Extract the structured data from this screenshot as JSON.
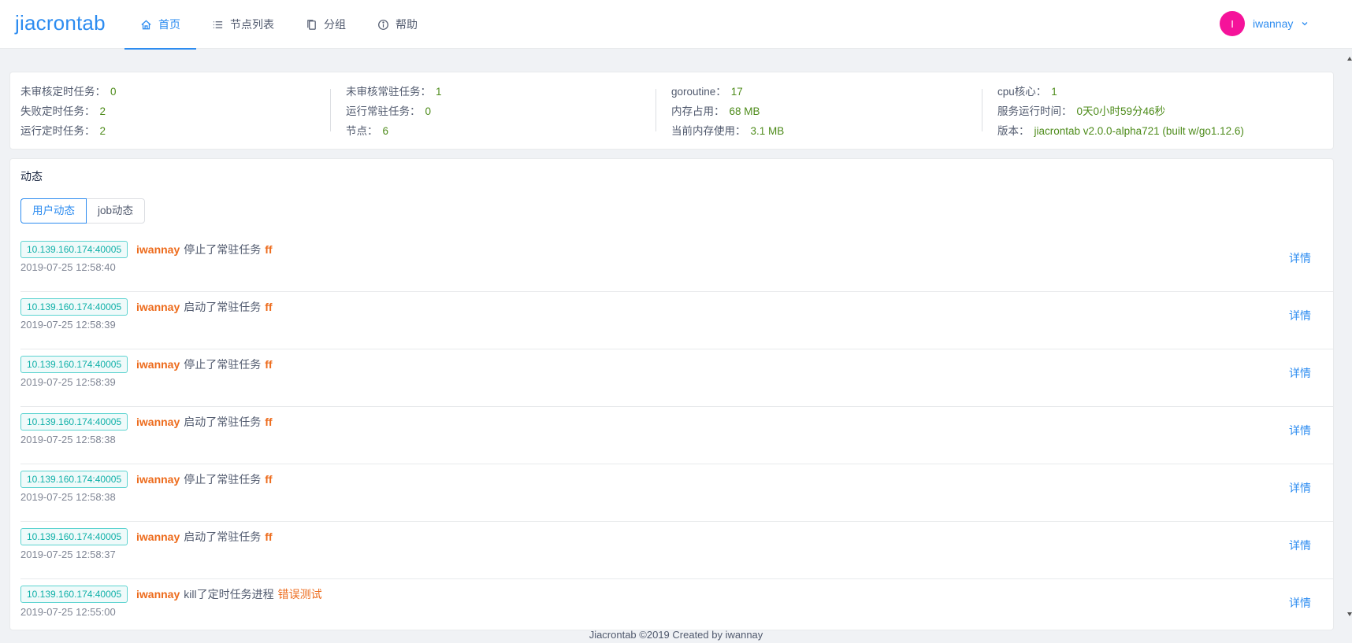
{
  "app": {
    "logo": "jiacrontab"
  },
  "nav": [
    {
      "label": "首页",
      "icon": "home-icon",
      "active": true
    },
    {
      "label": "节点列表",
      "icon": "list-icon",
      "active": false
    },
    {
      "label": "分组",
      "icon": "copy-icon",
      "active": false
    },
    {
      "label": "帮助",
      "icon": "info-icon",
      "active": false
    }
  ],
  "user": {
    "avatar_letter": "I",
    "name": "iwannay",
    "avatar_color": "#f5139a"
  },
  "stats": [
    [
      {
        "label": "未审核定时任务：",
        "value": "0"
      },
      {
        "label": "失败定时任务：",
        "value": "2"
      },
      {
        "label": "运行定时任务：",
        "value": "2"
      }
    ],
    [
      {
        "label": "未审核常驻任务：",
        "value": "1"
      },
      {
        "label": "运行常驻任务：",
        "value": "0"
      },
      {
        "label": "节点：",
        "value": "6"
      }
    ],
    [
      {
        "label": "goroutine：",
        "value": "17"
      },
      {
        "label": "内存占用：",
        "value": "68 MB"
      },
      {
        "label": "当前内存使用：",
        "value": "3.1 MB"
      }
    ],
    [
      {
        "label": "cpu核心：",
        "value": "1"
      },
      {
        "label": "服务运行时间：",
        "value": "0天0小时59分46秒"
      },
      {
        "label": "版本：",
        "value": "jiacrontab v2.0.0-alpha721 (built w/go1.12.6)"
      }
    ]
  ],
  "activity": {
    "title": "动态",
    "tabs": [
      {
        "label": "用户动态",
        "active": true
      },
      {
        "label": "job动态",
        "active": false
      }
    ],
    "detail_label": "详情",
    "items": [
      {
        "addr": "10.139.160.174:40005",
        "user": "iwannay",
        "action": "停止了常驻任务",
        "target": "ff",
        "time": "2019-07-25 12:58:40"
      },
      {
        "addr": "10.139.160.174:40005",
        "user": "iwannay",
        "action": "启动了常驻任务",
        "target": "ff",
        "time": "2019-07-25 12:58:39"
      },
      {
        "addr": "10.139.160.174:40005",
        "user": "iwannay",
        "action": "停止了常驻任务",
        "target": "ff",
        "time": "2019-07-25 12:58:39"
      },
      {
        "addr": "10.139.160.174:40005",
        "user": "iwannay",
        "action": "启动了常驻任务",
        "target": "ff",
        "time": "2019-07-25 12:58:38"
      },
      {
        "addr": "10.139.160.174:40005",
        "user": "iwannay",
        "action": "停止了常驻任务",
        "target": "ff",
        "time": "2019-07-25 12:58:38"
      },
      {
        "addr": "10.139.160.174:40005",
        "user": "iwannay",
        "action": "启动了常驻任务",
        "target": "ff",
        "time": "2019-07-25 12:58:37"
      },
      {
        "addr": "10.139.160.174:40005",
        "user": "iwannay",
        "action": "kill了定时任务进程",
        "target": "错误测试",
        "time": "2019-07-25 12:55:00"
      }
    ]
  },
  "footer": "Jiacrontab ©2019 Created by iwannay",
  "colors": {
    "accent": "#2d8cf0",
    "value_green": "#4d8b1a",
    "highlight_orange": "#ed6b1c",
    "tag_cyan": "#0fb0a8"
  }
}
